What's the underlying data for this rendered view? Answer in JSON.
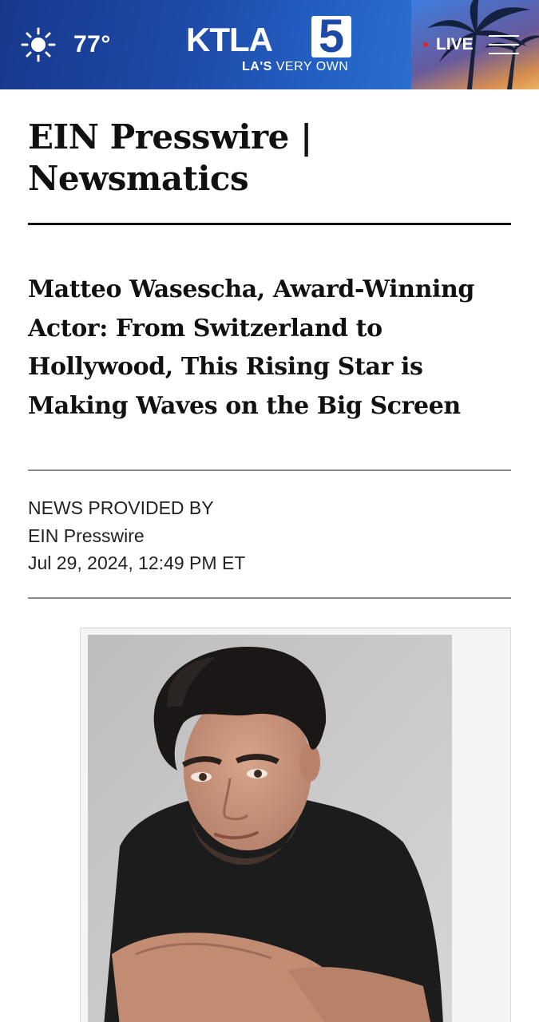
{
  "header": {
    "weather": {
      "icon": "sun-icon",
      "temperature": "77°"
    },
    "logo": {
      "wordmark": "KTLA",
      "number": "5",
      "tagline_bold": "LA'S",
      "tagline_rest": " VERY OWN"
    },
    "live_label": "LIVE",
    "menu_icon": "hamburger-menu-icon",
    "colors": {
      "bar": "#1e4aa8",
      "live_dot": "#e3262e"
    }
  },
  "article": {
    "source_title": "EIN Presswire | Newsmatics",
    "headline": "Matteo Wasescha, Award-Winning Actor: From Switzerland to Hollywood, This Rising Star is Making Waves on the Big Screen",
    "meta": {
      "provided_by_label": "NEWS PROVIDED BY",
      "provider": "EIN Presswire",
      "date": "Jul 29, 2024, 12:49 PM ET"
    },
    "image": {
      "alt": "Portrait photo of Matteo Wasescha"
    }
  }
}
